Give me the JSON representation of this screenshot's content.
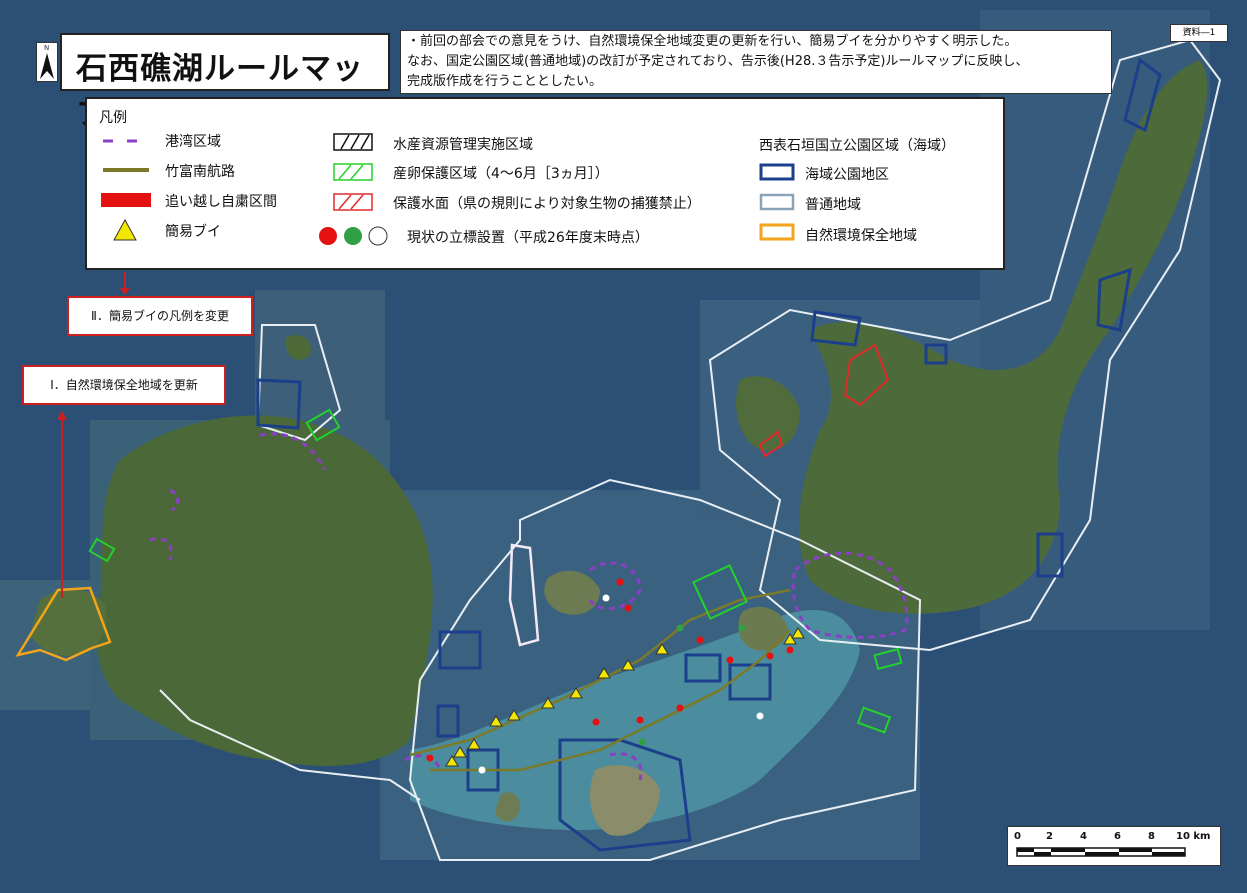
{
  "title": "石西礁湖ルールマップ",
  "north_label": "N",
  "doc_label": "資料―1",
  "note_lines": [
    "・前回の部会での意見をうけ、自然環境保全地域変更の更新を行い、簡易ブイを分かりやすく明示した。",
    "なお、国定公園区域(普通地域)の改訂が予定されており、告示後(H28.３告示予定)ルールマップに反映し、",
    "完成版作成を行うこととしたい。"
  ],
  "legend": {
    "heading": "凡例",
    "items": {
      "port": "港湾区域",
      "route": "竹富南航路",
      "overtake": "追い越し自粛区間",
      "buoy": "簡易ブイ",
      "fishery": "水産資源管理実施区域",
      "spawning": "産卵保護区域（4～6月［3ヵ月］）",
      "protected_water": "保護水面（県の規則により対象生物の捕獲禁止）",
      "markers": "現状の立標設置（平成26年度末時点）",
      "park_heading": "西表石垣国立公園区域（海域）",
      "marine_park": "海域公園地区",
      "ordinary": "普通地域",
      "nature_conservation": "自然環境保全地域"
    }
  },
  "callouts": {
    "buoy_change": "Ⅱ．簡易ブイの凡例を変更",
    "conservation_update": "Ⅰ．自然環境保全地域を更新"
  },
  "scale": {
    "ticks": [
      "0",
      "2",
      "4",
      "6",
      "8",
      "10 km"
    ]
  },
  "colors": {
    "sea": "#2c4f76",
    "land": "#4f6b3a",
    "reef": "#5fa3a9",
    "port": "#8a3fc4",
    "route": "#7b7a2a",
    "overtake": "#e51010",
    "buoy": "#f3e700",
    "spawning": "#22d12a",
    "protected_water": "#e02a2a",
    "marine_park": "#1c3f8c",
    "ordinary": "#dde8ee",
    "conservation": "#f2a51a",
    "callout_border": "#cc1f1f"
  }
}
